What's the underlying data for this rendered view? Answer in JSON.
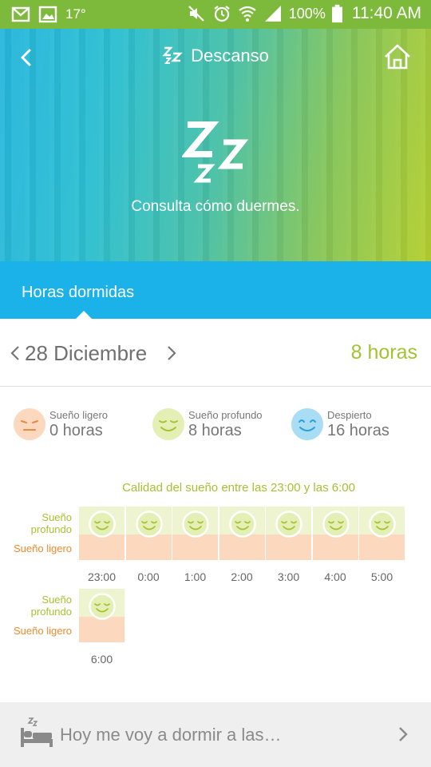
{
  "status_bar": {
    "temperature": "17°",
    "battery": "100%",
    "time": "11:40 AM",
    "icons": [
      "gmail-icon",
      "gallery-icon",
      "mute-icon",
      "alarm-icon",
      "wifi-icon",
      "signal-icon",
      "battery-icon"
    ],
    "color": "#7dba3c"
  },
  "header": {
    "title": "Descanso",
    "subtitle": "Consulta cómo duermes.",
    "icons": [
      "back-arrow-icon",
      "sleep-zz-icon",
      "home-icon"
    ]
  },
  "tab": {
    "label": "Horas dormidas",
    "color": "#1ab2e8"
  },
  "date_row": {
    "date": "28 Diciembre",
    "total": "8 horas",
    "accent": "#a6c132"
  },
  "legend": [
    {
      "label": "Sueño ligero",
      "value": "0 horas",
      "face_color": "#fcd8be"
    },
    {
      "label": "Sueño profundo",
      "value": "8 horas",
      "face_color": "#e4efb5"
    },
    {
      "label": "Despierto",
      "value": "16 horas",
      "face_color": "#a9dcf5"
    }
  ],
  "chart": {
    "title": "Calidad del sueño entre las 23:00 y las 6:00",
    "row_labels": {
      "deep": "Sueño profundo",
      "light": "Sueño ligero"
    },
    "hours": [
      "23:00",
      "0:00",
      "1:00",
      "2:00",
      "3:00",
      "4:00",
      "5:00",
      "6:00"
    ],
    "state_per_hour": [
      "deep",
      "deep",
      "deep",
      "deep",
      "deep",
      "deep",
      "deep",
      "deep"
    ]
  },
  "bottom_bar": {
    "text": "Hoy me voy a dormir a las…",
    "icon": "bed-icon"
  }
}
